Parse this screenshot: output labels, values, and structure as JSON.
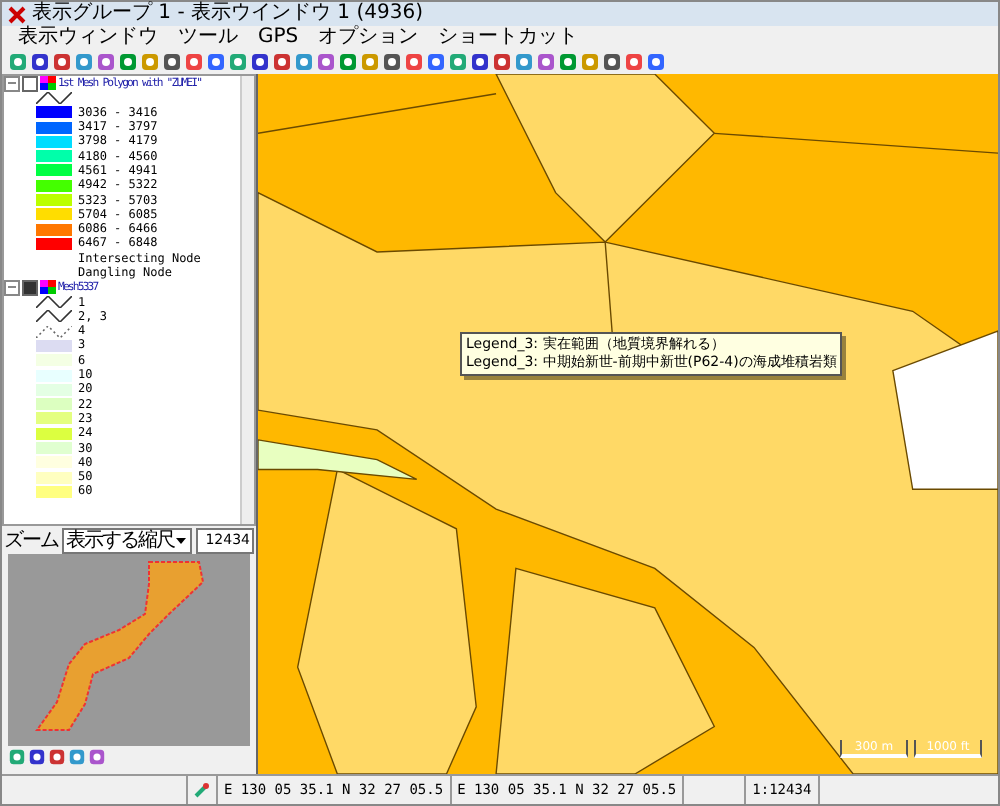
{
  "window": {
    "title": "表示グループ 1 - 表示ウインドウ 1 (4936)"
  },
  "menu": [
    "表示ウィンドウ",
    "ツール",
    "GPS",
    "オプション",
    "ショートカット"
  ],
  "layers": [
    {
      "name": "1st Mesh Polygon with \"ZUMEI\"",
      "checked": false,
      "expanded": true,
      "items": [
        {
          "kind": "line"
        },
        {
          "kind": "swatch",
          "label": "3036 - 3416",
          "color": "#0000ff"
        },
        {
          "kind": "swatch",
          "label": "3417 - 3797",
          "color": "#0066ff"
        },
        {
          "kind": "swatch",
          "label": "3798 - 4179",
          "color": "#00ddff"
        },
        {
          "kind": "swatch",
          "label": "4180 - 4560",
          "color": "#00ffaa"
        },
        {
          "kind": "swatch",
          "label": "4561 - 4941",
          "color": "#00ff44"
        },
        {
          "kind": "swatch",
          "label": "4942 - 5322",
          "color": "#44ff00"
        },
        {
          "kind": "swatch",
          "label": "5323 - 5703",
          "color": "#bbff00"
        },
        {
          "kind": "swatch",
          "label": "5704 - 6085",
          "color": "#ffdd00"
        },
        {
          "kind": "swatch",
          "label": "6086 - 6466",
          "color": "#ff7700"
        },
        {
          "kind": "swatch",
          "label": "6467 - 6848",
          "color": "#ff0000"
        },
        {
          "kind": "text",
          "label": "Intersecting Node"
        },
        {
          "kind": "text",
          "label": "Dangling Node"
        }
      ]
    },
    {
      "name": "Mesh5337",
      "checked": true,
      "expanded": true,
      "items": [
        {
          "kind": "line",
          "label": "1"
        },
        {
          "kind": "line",
          "label": "2, 3"
        },
        {
          "kind": "dotted",
          "label": "4"
        },
        {
          "kind": "swatch",
          "label": "3",
          "color": "#dcdcf2"
        },
        {
          "kind": "swatch",
          "label": "6",
          "color": "#f4ffe4"
        },
        {
          "kind": "swatch",
          "label": "10",
          "color": "#e8ffff"
        },
        {
          "kind": "swatch",
          "label": "20",
          "color": "#e4ffe4"
        },
        {
          "kind": "swatch",
          "label": "22",
          "color": "#dcffc0"
        },
        {
          "kind": "swatch",
          "label": "23",
          "color": "#e4ff80"
        },
        {
          "kind": "swatch",
          "label": "24",
          "color": "#dcff40"
        },
        {
          "kind": "swatch",
          "label": "30",
          "color": "#e0ffd0"
        },
        {
          "kind": "swatch",
          "label": "40",
          "color": "#ffffe0"
        },
        {
          "kind": "swatch",
          "label": "50",
          "color": "#ffffc0"
        },
        {
          "kind": "swatch",
          "label": "60",
          "color": "#ffff80"
        }
      ]
    }
  ],
  "zoom": {
    "label": "ズーム",
    "mode": "表示する縮尺",
    "value": "12434"
  },
  "tooltip": [
    "Legend_3: 実在範囲（地質境界解れる）",
    "Legend_3: 中期始新世-前期中新世(P62-4)の海成堆積岩類"
  ],
  "scale_bar": [
    "300 m",
    "1000 ft"
  ],
  "status_bar": {
    "position": "E 130 05 35.1   N 32 27 05.5",
    "cursor": "E 130 05 35.1   N 32 27 05.5",
    "scale": "1:12434"
  }
}
